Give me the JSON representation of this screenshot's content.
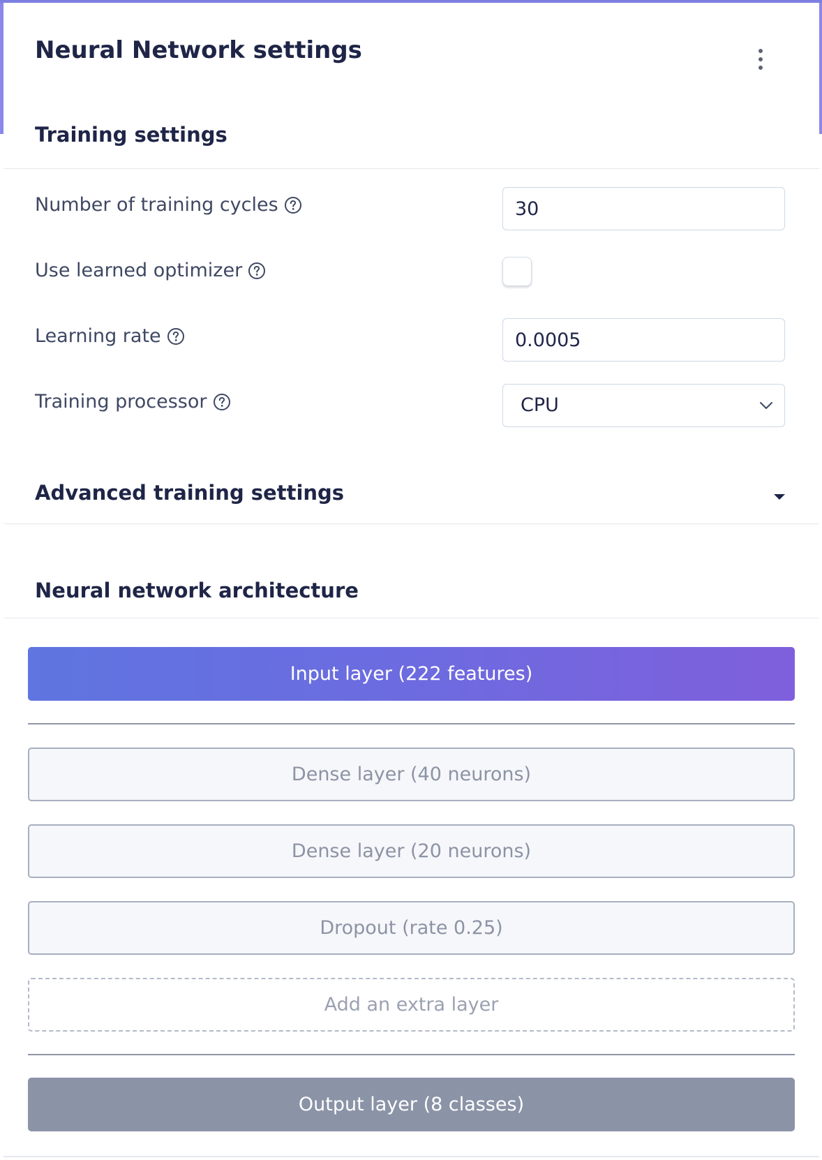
{
  "header": {
    "title": "Neural Network settings",
    "menu_icon": "kebab-menu-icon"
  },
  "training": {
    "section_title": "Training settings",
    "cycles": {
      "label": "Number of training cycles",
      "value": "30"
    },
    "learned_optimizer": {
      "label": "Use learned optimizer",
      "checked": false
    },
    "learning_rate": {
      "label": "Learning rate",
      "value": "0.0005"
    },
    "processor": {
      "label": "Training processor",
      "selected": "CPU"
    },
    "help_icon": "question-circle-icon"
  },
  "advanced": {
    "title": "Advanced training settings",
    "expanded": false,
    "caret_icon": "caret-down-icon"
  },
  "architecture": {
    "title": "Neural network architecture",
    "input_layer": "Input layer (222 features)",
    "layers": [
      "Dense layer (40 neurons)",
      "Dense layer (20 neurons)",
      "Dropout (rate 0.25)"
    ],
    "add_layer": "Add an extra layer",
    "output_layer": "Output layer (8 classes)"
  },
  "colors": {
    "accent": "#7c7fe0",
    "input_gradient_start": "#5f75e0",
    "input_gradient_end": "#7f5fdc",
    "output_layer_bg": "#8b93a7",
    "text_primary": "#1f2547",
    "text_muted": "#8c93a4"
  }
}
